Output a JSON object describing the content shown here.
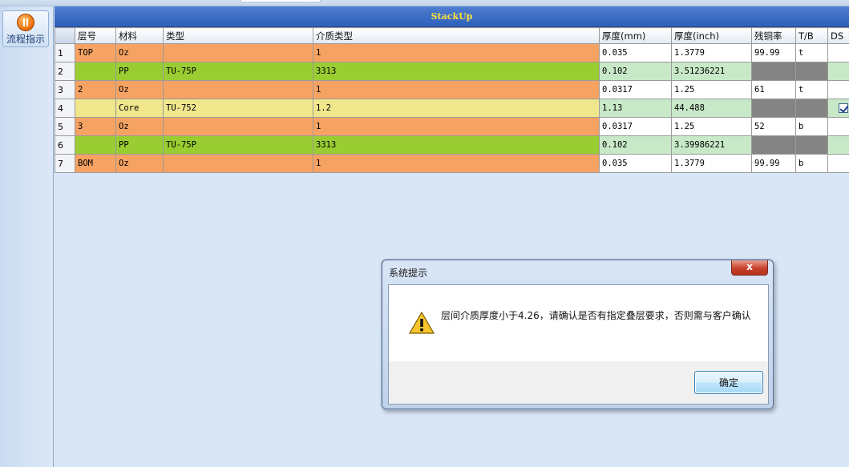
{
  "sidebar": {
    "flow_button_label": "流程指示"
  },
  "panel": {
    "title": "StackUp"
  },
  "table": {
    "columns": [
      "层号",
      "材料",
      "类型",
      "介质类型",
      "厚度(mm)",
      "厚度(inch)",
      "残铜率",
      "T/B",
      "DS"
    ],
    "rows": [
      {
        "num": "1",
        "layer": "TOP",
        "material": "Oz",
        "type": "",
        "dielectric": "1",
        "thick_mm": "0.035",
        "thick_inch": "1.3779",
        "copper": "99.99",
        "tb": "t",
        "ds": ""
      },
      {
        "num": "2",
        "layer": "",
        "material": "PP",
        "type": "TU-75P",
        "dielectric": "3313",
        "thick_mm": "0.102",
        "thick_inch": "3.51236221",
        "copper": "",
        "tb": "",
        "ds": ""
      },
      {
        "num": "3",
        "layer": "2",
        "material": "Oz",
        "type": "",
        "dielectric": "1",
        "thick_mm": "0.0317",
        "thick_inch": "1.25",
        "copper": "61",
        "tb": "t",
        "ds": ""
      },
      {
        "num": "4",
        "layer": "",
        "material": "Core",
        "type": "TU-752",
        "dielectric": "1.2",
        "thick_mm": "1.13",
        "thick_inch": "44.488",
        "copper": "",
        "tb": "",
        "ds": "checked"
      },
      {
        "num": "5",
        "layer": "3",
        "material": "Oz",
        "type": "",
        "dielectric": "1",
        "thick_mm": "0.0317",
        "thick_inch": "1.25",
        "copper": "52",
        "tb": "b",
        "ds": ""
      },
      {
        "num": "6",
        "layer": "",
        "material": "PP",
        "type": "TU-75P",
        "dielectric": "3313",
        "thick_mm": "0.102",
        "thick_inch": "3.39986221",
        "copper": "",
        "tb": "",
        "ds": ""
      },
      {
        "num": "7",
        "layer": "BOM",
        "material": "Oz",
        "type": "",
        "dielectric": "1",
        "thick_mm": "0.035",
        "thick_inch": "1.3779",
        "copper": "99.99",
        "tb": "b",
        "ds": ""
      }
    ]
  },
  "colors": {
    "copper_row": "#f6a263",
    "prepreg_row": "#9acd32",
    "core_row": "#f0e68c",
    "dielectric_thickness": "#c8e9c8",
    "disabled_cell": "#848484",
    "title_text": "#ffe23a"
  },
  "dialog": {
    "title": "系统提示",
    "close_glyph": "x",
    "message": "层间介质厚度小于4.26，请确认是否有指定叠层要求，否则需与客户确认",
    "ok_label": "确定",
    "icon": "warning-icon"
  }
}
